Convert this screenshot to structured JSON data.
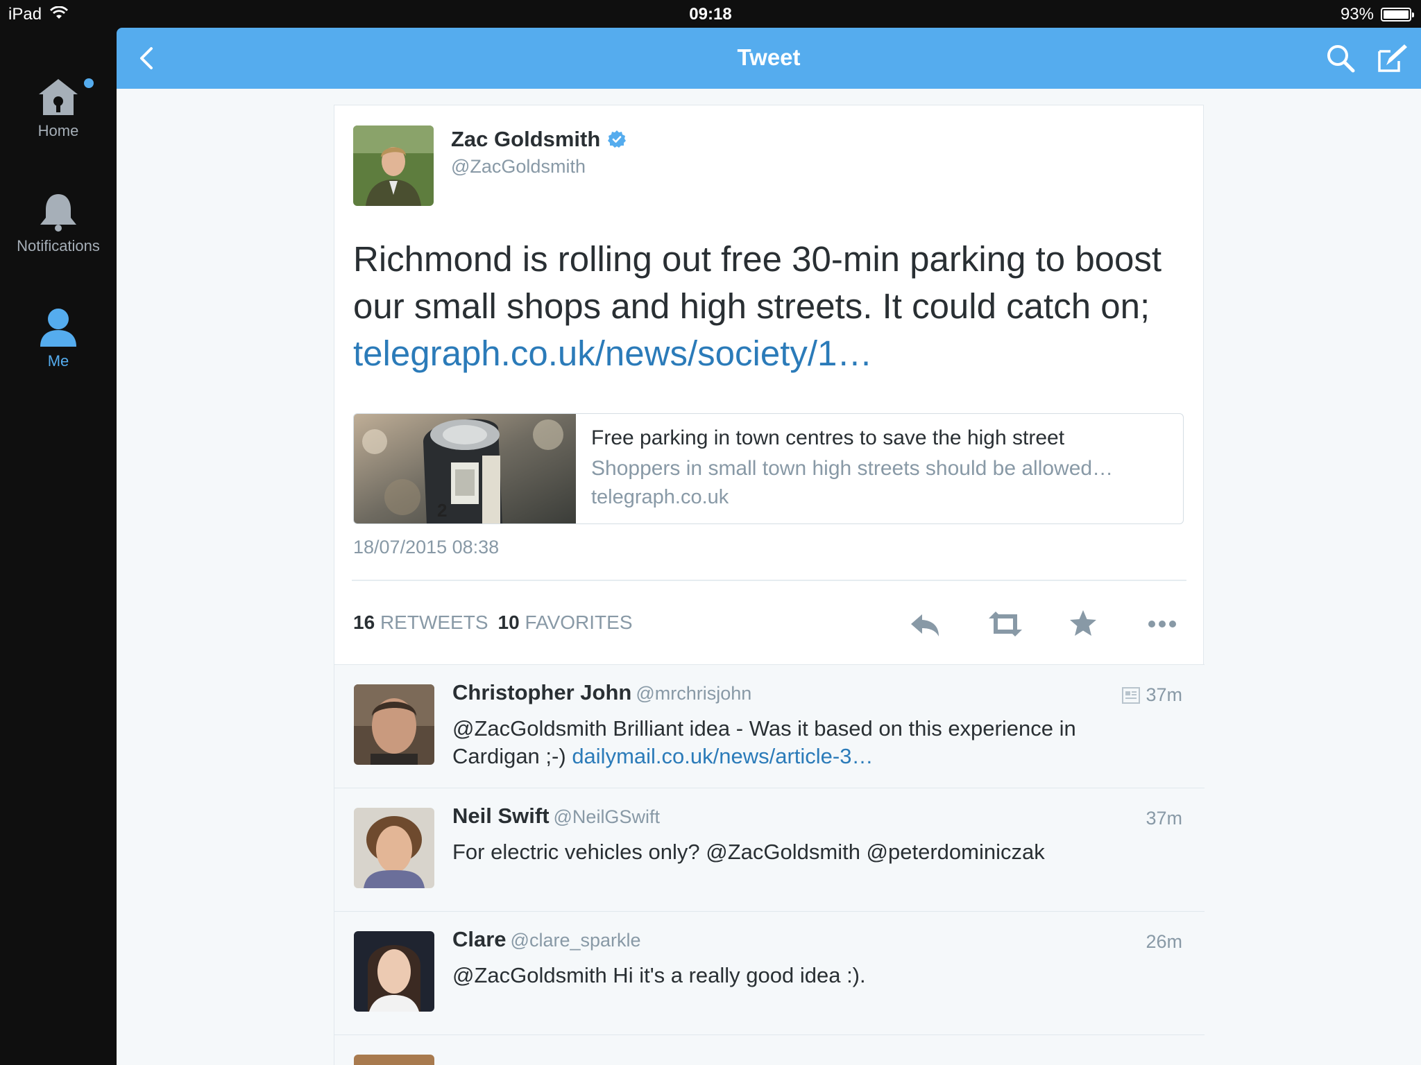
{
  "status_bar": {
    "device": "iPad",
    "time": "09:18",
    "battery": "93%"
  },
  "sidebar": {
    "items": [
      {
        "label": "Home",
        "icon": "home-icon",
        "active": false
      },
      {
        "label": "Notifications",
        "icon": "bell-icon",
        "active": false
      },
      {
        "label": "Me",
        "icon": "person-icon",
        "active": true
      }
    ]
  },
  "header": {
    "title": "Tweet"
  },
  "tweet": {
    "author_name": "Zac Goldsmith",
    "author_handle": "@ZacGoldsmith",
    "text": "Richmond is rolling out free 30-min parking to boost our small shops and high streets. It could catch on;",
    "link": "telegraph.co.uk/news/society/1…",
    "card": {
      "title": "Free parking in town centres to save the high street",
      "description": "Shoppers in small town high streets should be allowed…",
      "domain": "telegraph.co.uk"
    },
    "timestamp": "18/07/2015 08:38",
    "retweets_count": "16",
    "retweets_label": "RETWEETS",
    "favorites_count": "10",
    "favorites_label": "FAVORITES"
  },
  "replies": [
    {
      "name": "Christopher John",
      "handle": "@mrchrisjohn",
      "time": "37m",
      "text": "@ZacGoldsmith Brilliant idea - Was it based on this experience in Cardigan ;-)",
      "link": "dailymail.co.uk/news/article-3…",
      "has_card_icon": true
    },
    {
      "name": "Neil Swift",
      "handle": "@NeilGSwift",
      "time": "37m",
      "text": "For electric vehicles only? @ZacGoldsmith @peterdominiczak",
      "link": ""
    },
    {
      "name": "Clare",
      "handle": "@clare_sparkle",
      "time": "26m",
      "text": "@ZacGoldsmith Hi it's a really good idea :).",
      "link": ""
    }
  ],
  "colors": {
    "brand": "#55acee",
    "link": "#2b7bb9",
    "muted": "#8899a6",
    "text": "#292f33"
  }
}
